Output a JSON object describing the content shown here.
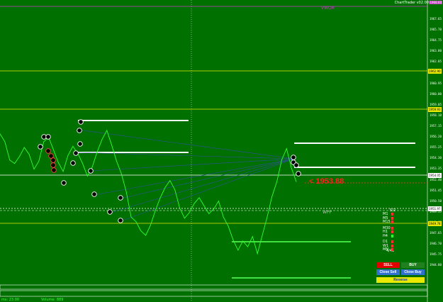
{
  "app": {
    "brand": "ChartTrader v02.00",
    "indicator_label": "VWOR"
  },
  "price_axis": {
    "labels": [
      "1967.65",
      "1965.70",
      "1964.75",
      "1963.80",
      "1962.85",
      "1961.90",
      "1960.95",
      "1960.00",
      "1959.05",
      "1958.10",
      "1957.15",
      "1956.20",
      "1955.25",
      "1954.30",
      "1953.35",
      "1952.40",
      "1951.45",
      "1950.50",
      "1949.55",
      "1948.60",
      "1947.65",
      "1946.70",
      "1945.75",
      "1944.80"
    ],
    "top_tag": "1968.60",
    "tags": [
      {
        "text": "1962.90",
        "color": "#e8e800"
      },
      {
        "text": "1959.93",
        "color": "#e8e800"
      },
      {
        "text": "1954.05",
        "color": "#ffffff"
      },
      {
        "text": "1951.97",
        "color": "#ffffff"
      },
      {
        "text": "1949.78",
        "color": "#e8e800"
      }
    ]
  },
  "current_price": {
    "arrow": "<",
    "value": "1953.88"
  },
  "level_labels": {
    "wpp": "WPP"
  },
  "timeframes": {
    "rows": [
      {
        "label": "M1",
        "color": "#ff3030"
      },
      {
        "label": "M5",
        "color": "#ff3030"
      },
      {
        "label": "M15",
        "color": "#ff3030"
      },
      {
        "label": "M30",
        "color": "#ff3030"
      },
      {
        "label": "H1",
        "color": "#ff3030"
      },
      {
        "label": "H4",
        "color": "#30ff30"
      },
      {
        "label": "D1",
        "color": "#ff3030"
      },
      {
        "label": "W1",
        "color": "#ff3030"
      },
      {
        "label": "MN",
        "color": "#ff3030"
      }
    ],
    "top_count": "5/2",
    "bottom_count": "4/41"
  },
  "buttons": {
    "sell": "SELL",
    "buy": "BUY",
    "close_sell": "Close Sell",
    "close_buy": "Close Buy",
    "reverse": "Reverse"
  },
  "status": {
    "left": "ms: 23.00",
    "right": "Volume: 889"
  },
  "colors": {
    "background": "#007000",
    "price_line": "#30ff30",
    "level_yellow": "#e8e800",
    "sell": "#e00000",
    "buy": "#208020",
    "close": "#3070d0",
    "reverse": "#e8e800"
  },
  "chart_data": {
    "type": "line",
    "ylim": [
      1944.5,
      1968.6
    ],
    "series": [
      {
        "values": [
          1957.5,
          1956.8,
          1955.2,
          1954.9,
          1955.5,
          1956.3,
          1955.7,
          1954.4,
          1955.1,
          1956.8,
          1957.2,
          1956.1,
          1955.0,
          1954.2,
          1955.6,
          1956.4,
          1955.8,
          1954.9,
          1953.8,
          1954.6,
          1955.9,
          1957.0,
          1957.8,
          1956.5,
          1955.1,
          1954.0,
          1952.4,
          1950.2,
          1949.8,
          1949.0,
          1948.6,
          1949.5,
          1950.8,
          1951.9,
          1952.8,
          1953.4,
          1952.6,
          1951.0,
          1950.1,
          1950.6,
          1951.4,
          1951.9,
          1951.2,
          1950.5,
          1950.9,
          1951.6,
          1950.2,
          1949.4,
          1948.2,
          1947.3,
          1948.1,
          1947.6,
          1948.5,
          1947.0,
          1948.6,
          1950.2,
          1952.0,
          1953.3,
          1955.2,
          1956.2,
          1954.5,
          1953.3
        ]
      }
    ]
  }
}
